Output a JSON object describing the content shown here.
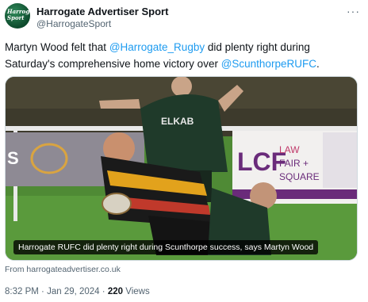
{
  "account": {
    "display_name": "Harrogate Advertiser Sport",
    "handle": "@HarrogateSport",
    "avatar_text": "Harrogate Sport"
  },
  "menu": {
    "more_glyph": "···"
  },
  "tweet": {
    "text_part1": "Martyn Wood felt that ",
    "mention1": "@Harrogate_Rugby",
    "text_part2": " did plenty right during Saturday's comprehensive home victory over ",
    "mention2": "@ScunthorpeRUFC",
    "text_part3": "."
  },
  "card": {
    "headline": "Harrogate RUFC did plenty right during Scunthorpe success, says Martyn Wood",
    "source": "From harrogateadvertiser.co.uk",
    "photo_texts": {
      "shirt_sponsor": "ELKAB",
      "board_left_letters": "S",
      "board_right_logo": "LCF",
      "board_right_line1": "LAW",
      "board_right_line2": "FAIR +",
      "board_right_line3": "SQUARE"
    }
  },
  "meta": {
    "time": "8:32 PM",
    "separator": "·",
    "date": "Jan 29, 2024",
    "views_count": "220",
    "views_label": "Views"
  },
  "colors": {
    "link": "#1d9bf0",
    "secondary_text": "#536471",
    "primary_text": "#0f1419"
  }
}
